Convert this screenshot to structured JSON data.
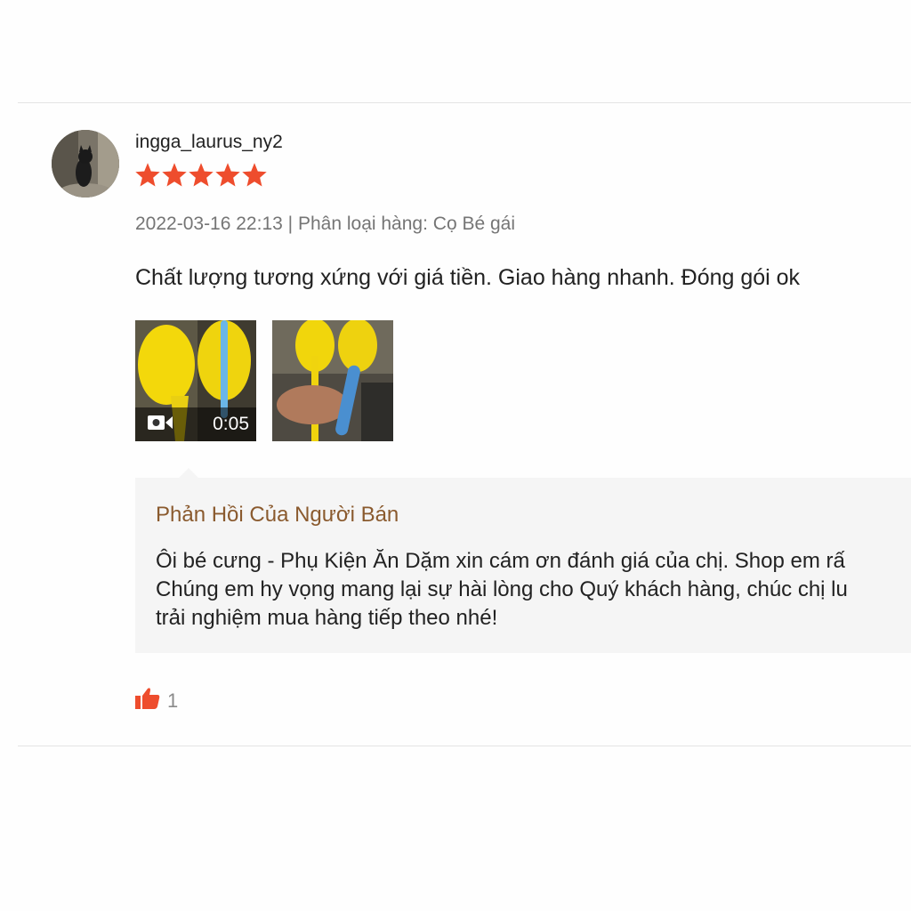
{
  "review": {
    "username": "ingga_laurus_ny2",
    "rating": 5,
    "rating_max": 5,
    "date": "2022-03-16 22:13",
    "separator": "|",
    "variant_label": "Phân loại hàng:",
    "variant_value": "Cọ Bé gái",
    "comment": "Chất lượng tương xứng với giá tiền. Giao hàng nhanh. Đóng gói ok",
    "media": [
      {
        "type": "video",
        "icon": "video-camera-icon",
        "duration": "0:05"
      },
      {
        "type": "image"
      }
    ],
    "seller_reply": {
      "title": "Phản Hồi Của Người Bán",
      "lines": [
        "Ôi bé cưng - Phụ Kiện Ăn Dặm xin cám ơn đánh giá của chị. Shop em rấ",
        "Chúng em hy vọng mang lại sự hài lòng cho Quý khách hàng, chúc chị lu",
        "trải nghiệm mua hàng tiếp theo nhé!"
      ]
    },
    "likes": {
      "icon": "thumbs-up-icon",
      "count": "1"
    }
  },
  "colors": {
    "star": "#ee4d2d",
    "like_icon": "#ee4d2d",
    "reply_title": "#8a5a2e",
    "reply_bg": "#f5f5f5"
  }
}
